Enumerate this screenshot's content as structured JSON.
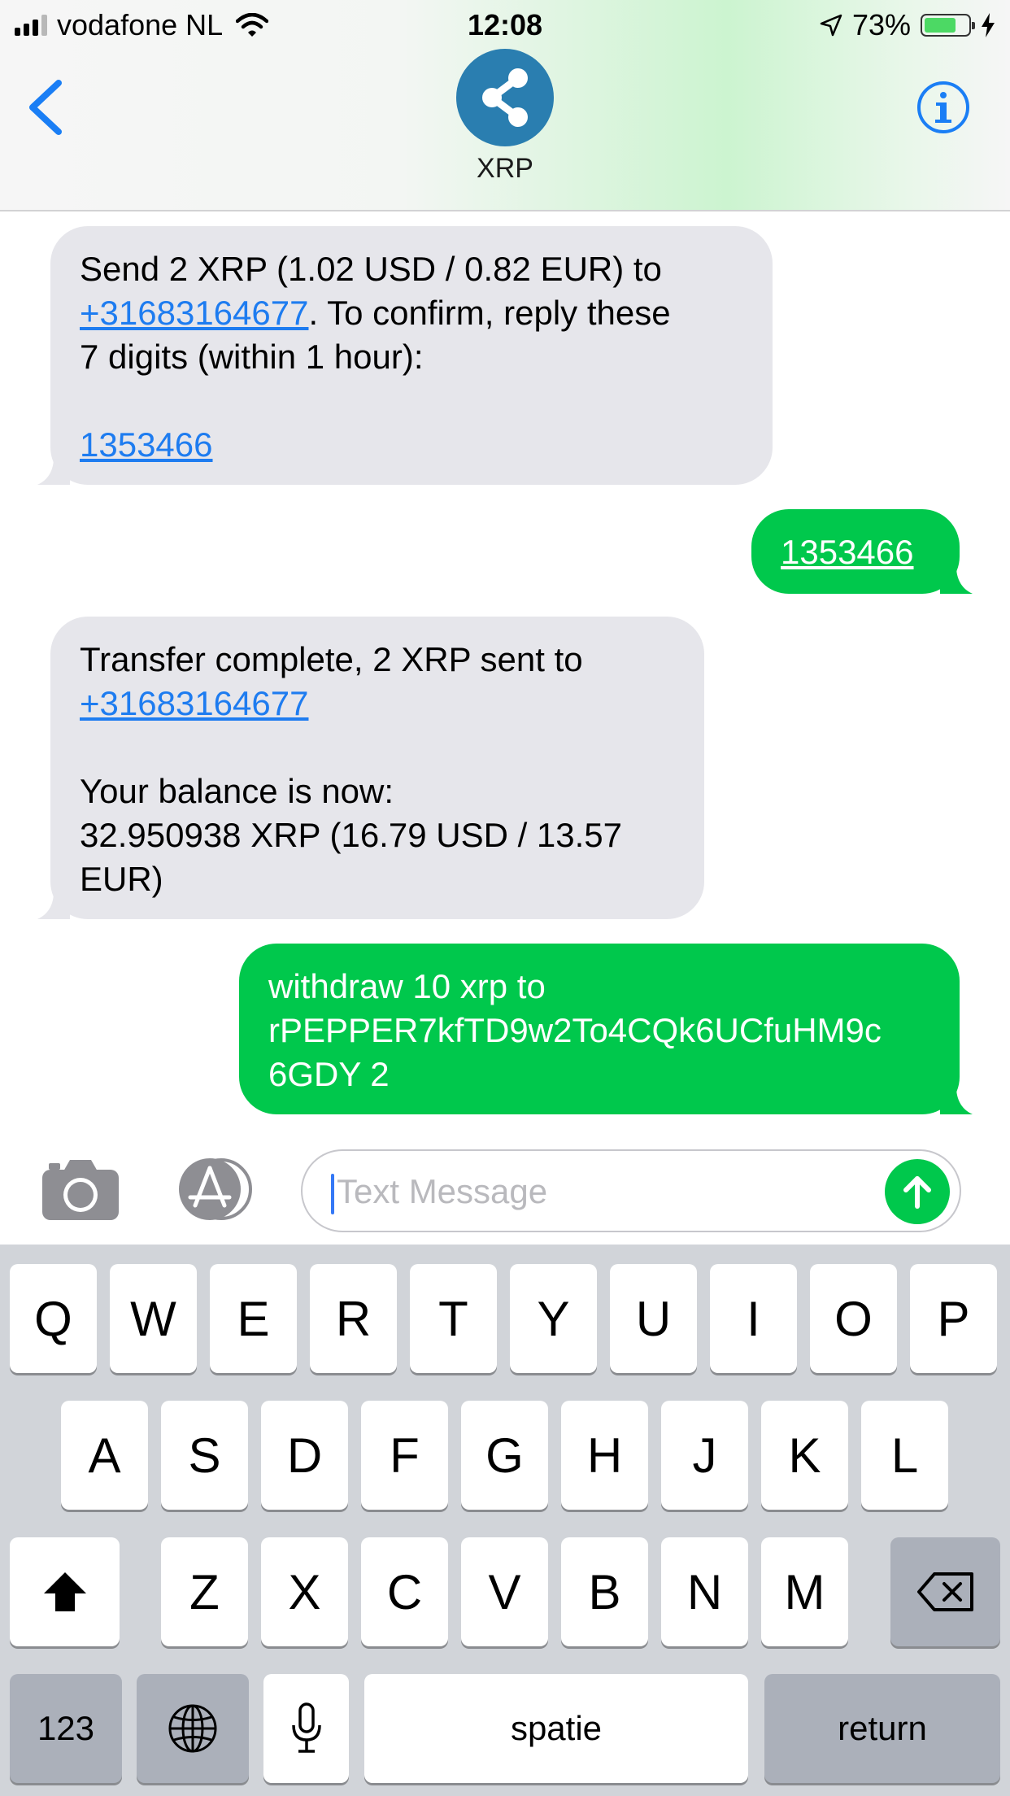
{
  "status_bar": {
    "carrier": "vodafone NL",
    "time": "12:08",
    "battery_percent": "73%",
    "battery_level": 0.73,
    "signal_bars_active": 3,
    "signal_bars_total": 4
  },
  "header": {
    "contact_name": "XRP",
    "back_icon": "chevron-left-icon",
    "info_icon": "info-icon",
    "avatar_icon": "xrp-logo-icon"
  },
  "messages": [
    {
      "direction": "incoming",
      "lines": [
        "Send 2 XRP (1.02 USD / 0.82 EUR) to",
        ". To confirm, reply these",
        "7 digits (within 1 hour):"
      ],
      "link_phone": "+31683164677",
      "link_code": "1353466"
    },
    {
      "direction": "outgoing",
      "text": "1353466"
    },
    {
      "direction": "incoming",
      "line1": "Transfer complete, 2 XRP sent to",
      "link_phone": "+31683164677",
      "balance_lines": [
        "Your balance is now:",
        "32.950938 XRP (16.79 USD / 13.57",
        "EUR)"
      ]
    },
    {
      "direction": "outgoing",
      "lines": [
        "withdraw 10 xrp to",
        "rPEPPER7kfTD9w2To4CQk6UCfuHM9c",
        "6GDY 2"
      ]
    }
  ],
  "input_bar": {
    "placeholder": "Text Message",
    "camera_icon": "camera-icon",
    "appstore_icon": "app-store-icon",
    "send_icon": "arrow-up-icon"
  },
  "keyboard": {
    "row1": [
      "Q",
      "W",
      "E",
      "R",
      "T",
      "Y",
      "U",
      "I",
      "O",
      "P"
    ],
    "row2": [
      "A",
      "S",
      "D",
      "F",
      "G",
      "H",
      "J",
      "K",
      "L"
    ],
    "row3": [
      "Z",
      "X",
      "C",
      "V",
      "B",
      "N",
      "M"
    ],
    "numbers_label": "123",
    "space_label": "spatie",
    "return_label": "return",
    "shift_icon": "shift-icon",
    "delete_icon": "backspace-icon",
    "globe_icon": "globe-icon",
    "mic_icon": "microphone-icon"
  },
  "colors": {
    "incoming_bubble": "#e6e6eb",
    "outgoing_bubble": "#00c84c",
    "link": "#1e7cf0",
    "accent": "#1a7ef5"
  }
}
